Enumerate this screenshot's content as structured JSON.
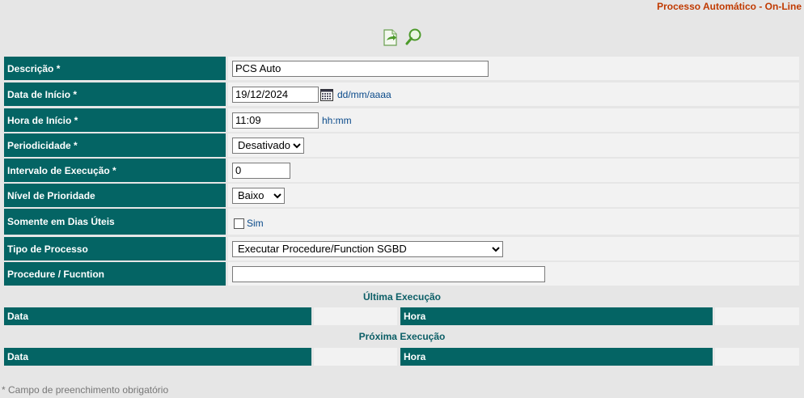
{
  "header": {
    "title": "Processo Automático - On-Line"
  },
  "toolbar": {
    "icons": [
      "add-document-icon",
      "search-icon"
    ]
  },
  "form": {
    "descricao": {
      "label": "Descrição *",
      "value": "PCS Auto"
    },
    "data_inicio": {
      "label": "Data de Início *",
      "value": "19/12/2024",
      "hint": "dd/mm/aaaa"
    },
    "hora_inicio": {
      "label": "Hora de Início *",
      "value": "11:09",
      "hint": "hh:mm"
    },
    "periodicidade": {
      "label": "Periodicidade *",
      "selected": "Desativado"
    },
    "intervalo": {
      "label": "Intervalo de Execução *",
      "value": "0"
    },
    "prioridade": {
      "label": "Nível de Prioridade",
      "selected": "Baixo"
    },
    "dias_uteis": {
      "label": "Somente em Dias Úteis",
      "checkbox_label": "Sim",
      "checked": false
    },
    "tipo_processo": {
      "label": "Tipo de Processo",
      "selected": "Executar Procedure/Function SGBD"
    },
    "procedure": {
      "label": "Procedure / Fucntion",
      "value": ""
    }
  },
  "ultima_execucao": {
    "title": "Última Execução",
    "data_label": "Data",
    "hora_label": "Hora"
  },
  "proxima_execucao": {
    "title": "Próxima Execução",
    "data_label": "Data",
    "hora_label": "Hora"
  },
  "footer": {
    "note": "* Campo de preenchimento obrigatório"
  },
  "colors": {
    "label_bg": "#046464",
    "title": "#c03a00",
    "section": "#0b5e66",
    "hint": "#0a4a8a"
  }
}
